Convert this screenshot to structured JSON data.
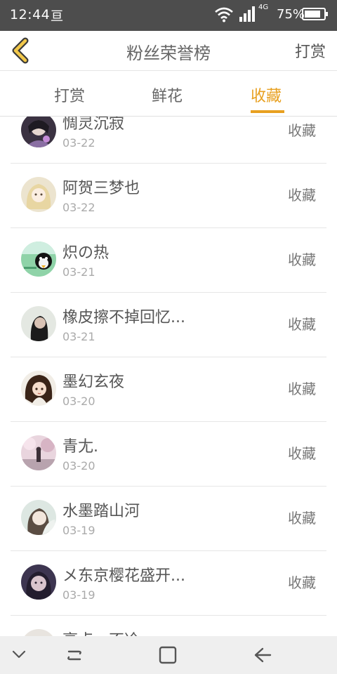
{
  "status_bar": {
    "time": "12:44",
    "notification_glyph": "亘",
    "network": "4G",
    "battery": "75%"
  },
  "header": {
    "title": "粉丝荣誉榜",
    "action": "打赏"
  },
  "tabs": [
    {
      "label": "打赏",
      "active": false
    },
    {
      "label": "鲜花",
      "active": false
    },
    {
      "label": "收藏",
      "active": true
    }
  ],
  "colors": {
    "accent": "#e8a020",
    "status_bar": "#4d4d4d"
  },
  "list": [
    {
      "name": "惆灵沉寂",
      "date": "03-22",
      "action": "收藏"
    },
    {
      "name": "阿贺三梦也",
      "date": "03-22",
      "action": "收藏"
    },
    {
      "name": "炽の热",
      "date": "03-21",
      "action": "收藏"
    },
    {
      "name": "橡皮擦不掉回忆...",
      "date": "03-21",
      "action": "收藏"
    },
    {
      "name": "墨幻玄夜",
      "date": "03-20",
      "action": "收藏"
    },
    {
      "name": "青尢.",
      "date": "03-20",
      "action": "收藏"
    },
    {
      "name": "水墨踏山河",
      "date": "03-19",
      "action": "收藏"
    },
    {
      "name": "メ东京樱花盛开...",
      "date": "03-19",
      "action": "收藏"
    },
    {
      "name": "亭点、不冷",
      "date": "",
      "action": ""
    }
  ]
}
